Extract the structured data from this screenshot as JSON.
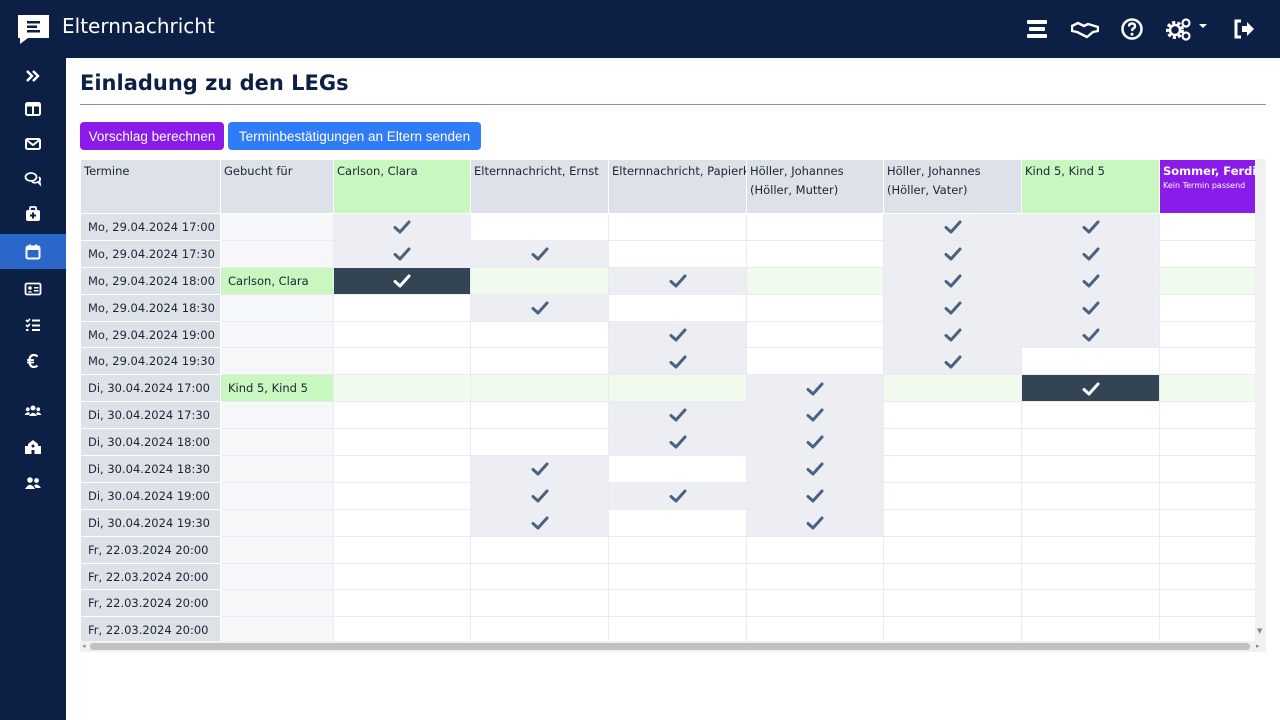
{
  "app": {
    "title": "Elternnachricht"
  },
  "topbar": {
    "icons": [
      "menu-lines-icon",
      "handshake-icon",
      "help-circle-icon",
      "settings-gears-icon",
      "logout-icon"
    ]
  },
  "sidebar": {
    "items": [
      {
        "icon": "double-chevron-right-icon",
        "active": false
      },
      {
        "icon": "layout-columns-icon",
        "active": false
      },
      {
        "icon": "envelope-icon",
        "active": false
      },
      {
        "icon": "chat-bubbles-icon",
        "active": false
      },
      {
        "icon": "first-aid-kit-icon",
        "active": false
      },
      {
        "icon": "calendar-icon",
        "active": true
      },
      {
        "icon": "id-card-icon",
        "active": false
      },
      {
        "icon": "checklist-icon",
        "active": false
      },
      {
        "icon": "euro-icon",
        "active": false
      },
      {
        "icon": "users-group-icon",
        "active": false
      },
      {
        "icon": "school-icon",
        "active": false
      },
      {
        "icon": "user-pair-icon",
        "active": false
      }
    ]
  },
  "page": {
    "title": "Einladung zu den LEGs"
  },
  "buttons": {
    "suggest": "Vorschlag berechnen",
    "send": "Terminbestätigungen an Eltern senden"
  },
  "table": {
    "header_termine": "Termine",
    "header_gebucht": "Gebucht für",
    "columns": [
      {
        "line1": "Carlson, Clara",
        "line2": "",
        "style": "green"
      },
      {
        "line1": "Elternnachricht, Ernst",
        "line2": "",
        "style": "grey"
      },
      {
        "line1": "Elternnachricht, Papierkind",
        "line2": "",
        "style": "grey"
      },
      {
        "line1": "Höller, Johannes",
        "line2": "(Höller, Mutter)",
        "style": "grey"
      },
      {
        "line1": "Höller, Johannes",
        "line2": "(Höller, Vater)",
        "style": "grey"
      },
      {
        "line1": "Kind 5, Kind 5",
        "line2": "",
        "style": "green"
      },
      {
        "line1": "Sommer, Ferdinand",
        "line2": "Kein Termin passend",
        "style": "purple"
      }
    ],
    "rows": [
      {
        "termin": "Mo, 29.04.2024 17:00",
        "gebucht": "",
        "cells": [
          "a",
          "p",
          "p",
          "p",
          "a",
          "a",
          "p"
        ]
      },
      {
        "termin": "Mo, 29.04.2024 17:30",
        "gebucht": "",
        "cells": [
          "a",
          "a",
          "p",
          "p",
          "a",
          "a",
          "p"
        ]
      },
      {
        "termin": "Mo, 29.04.2024 18:00",
        "gebucht": "Carlson, Clara",
        "cells": [
          "s",
          "p",
          "a",
          "p",
          "a",
          "a",
          "p"
        ]
      },
      {
        "termin": "Mo, 29.04.2024 18:30",
        "gebucht": "",
        "cells": [
          "p",
          "a",
          "p",
          "p",
          "a",
          "a",
          "p"
        ]
      },
      {
        "termin": "Mo, 29.04.2024 19:00",
        "gebucht": "",
        "cells": [
          "p",
          "p",
          "a",
          "p",
          "a",
          "a",
          "p"
        ]
      },
      {
        "termin": "Mo, 29.04.2024 19:30",
        "gebucht": "",
        "cells": [
          "p",
          "p",
          "a",
          "p",
          "a",
          "p",
          "p"
        ]
      },
      {
        "termin": "Di, 30.04.2024 17:00",
        "gebucht": "Kind 5, Kind 5",
        "cells": [
          "p",
          "p",
          "p",
          "a",
          "p",
          "s",
          "p"
        ]
      },
      {
        "termin": "Di, 30.04.2024 17:30",
        "gebucht": "",
        "cells": [
          "p",
          "p",
          "a",
          "a",
          "p",
          "p",
          "p"
        ]
      },
      {
        "termin": "Di, 30.04.2024 18:00",
        "gebucht": "",
        "cells": [
          "p",
          "p",
          "a",
          "a",
          "p",
          "p",
          "p"
        ]
      },
      {
        "termin": "Di, 30.04.2024 18:30",
        "gebucht": "",
        "cells": [
          "p",
          "a",
          "p",
          "a",
          "p",
          "p",
          "p"
        ]
      },
      {
        "termin": "Di, 30.04.2024 19:00",
        "gebucht": "",
        "cells": [
          "p",
          "a",
          "a",
          "a",
          "p",
          "p",
          "p"
        ]
      },
      {
        "termin": "Di, 30.04.2024 19:30",
        "gebucht": "",
        "cells": [
          "p",
          "a",
          "p",
          "a",
          "p",
          "p",
          "p"
        ]
      },
      {
        "termin": "Fr, 22.03.2024 20:00",
        "gebucht": "",
        "cells": [
          "p",
          "p",
          "p",
          "p",
          "p",
          "p",
          "p"
        ]
      },
      {
        "termin": "Fr, 22.03.2024 20:00",
        "gebucht": "",
        "cells": [
          "p",
          "p",
          "p",
          "p",
          "p",
          "p",
          "p"
        ]
      },
      {
        "termin": "Fr, 22.03.2024 20:00",
        "gebucht": "",
        "cells": [
          "p",
          "p",
          "p",
          "p",
          "p",
          "p",
          "p"
        ]
      },
      {
        "termin": "Fr, 22.03.2024 20:00",
        "gebucht": "",
        "cells": [
          "p",
          "p",
          "p",
          "p",
          "p",
          "p",
          "p"
        ]
      }
    ]
  },
  "colors": {
    "navy": "#0c1f44",
    "active": "#2b66c9",
    "purple": "#8a1be8",
    "blue": "#2f7cf6",
    "green": "#c8f7c0",
    "check": "#4a6280",
    "selected": "#334455"
  }
}
